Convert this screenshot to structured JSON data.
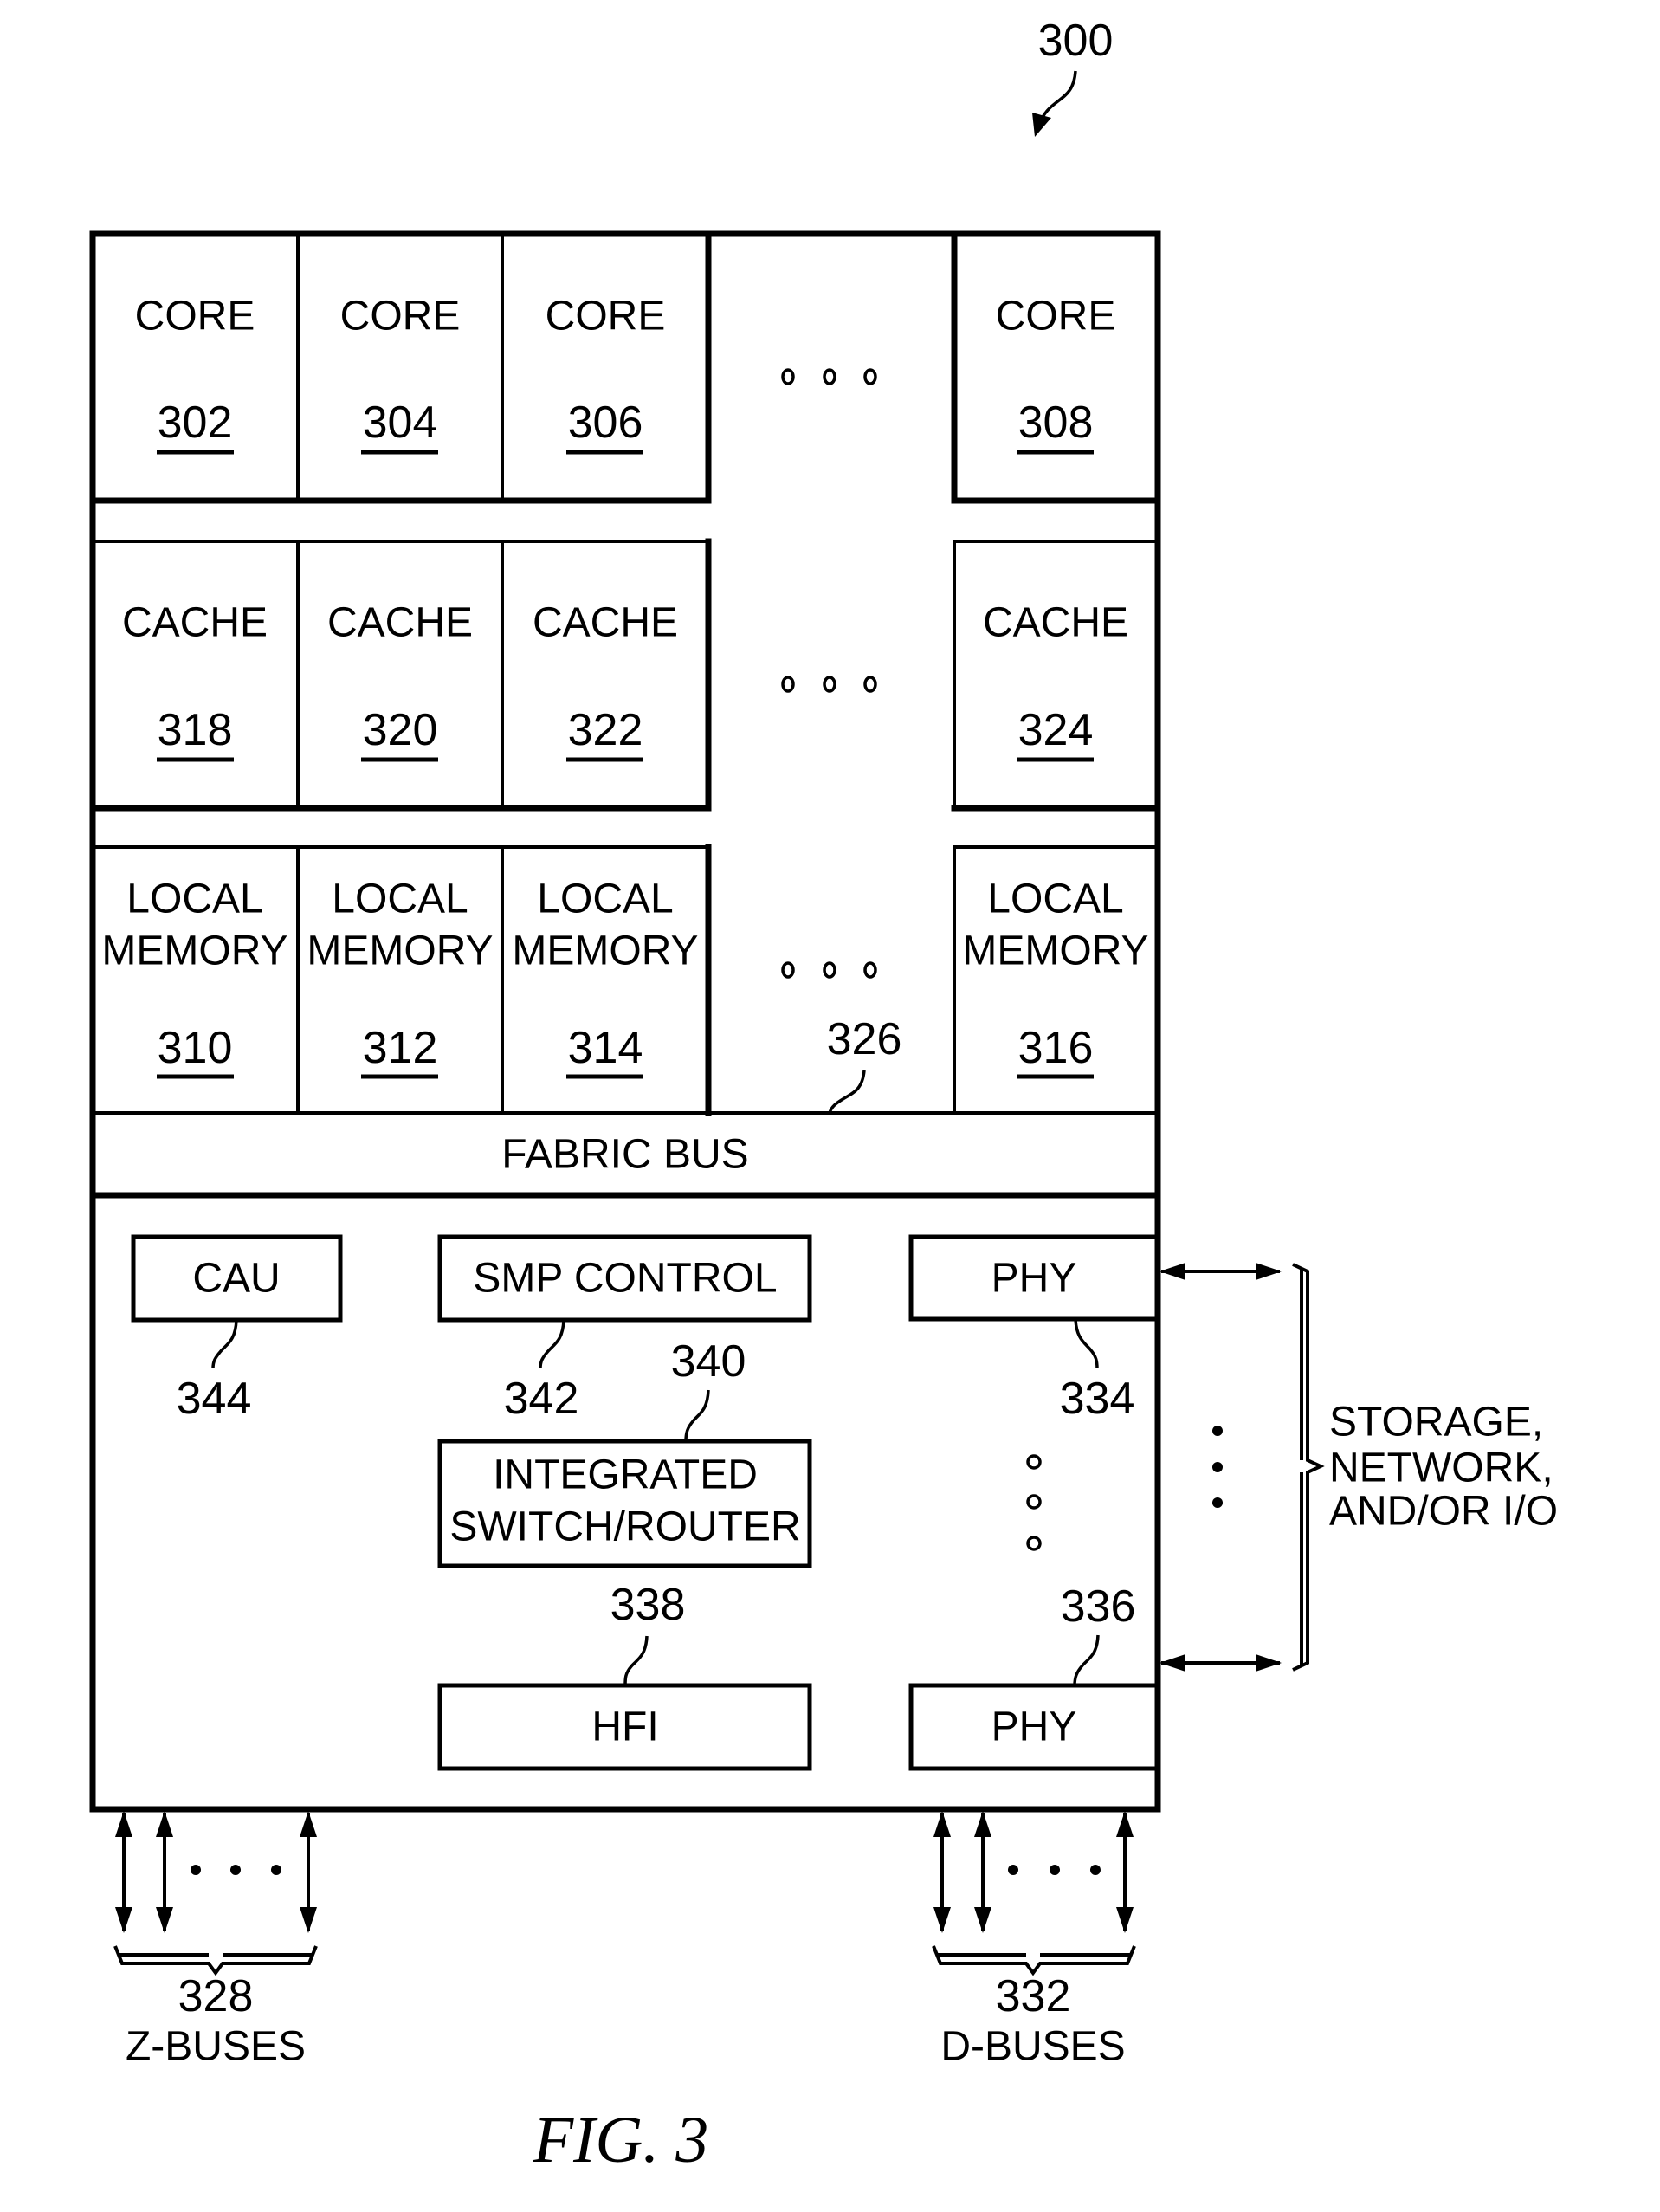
{
  "figure": {
    "ref": "300",
    "caption": "FIG. 3"
  },
  "cores": [
    {
      "label": "CORE",
      "ref": "302"
    },
    {
      "label": "CORE",
      "ref": "304"
    },
    {
      "label": "CORE",
      "ref": "306"
    },
    {
      "label": "CORE",
      "ref": "308"
    }
  ],
  "caches": [
    {
      "label": "CACHE",
      "ref": "318"
    },
    {
      "label": "CACHE",
      "ref": "320"
    },
    {
      "label": "CACHE",
      "ref": "322"
    },
    {
      "label": "CACHE",
      "ref": "324"
    }
  ],
  "memories": [
    {
      "line1": "LOCAL",
      "line2": "MEMORY",
      "ref": "310"
    },
    {
      "line1": "LOCAL",
      "line2": "MEMORY",
      "ref": "312"
    },
    {
      "line1": "LOCAL",
      "line2": "MEMORY",
      "ref": "314"
    },
    {
      "line1": "LOCAL",
      "line2": "MEMORY",
      "ref": "316"
    }
  ],
  "fabric_bus": {
    "label": "FABRIC BUS",
    "ref": "326"
  },
  "cau": {
    "label": "CAU",
    "ref": "344"
  },
  "smp_control": {
    "label": "SMP CONTROL",
    "ref": "342"
  },
  "switch_router": {
    "line1": "INTEGRATED",
    "line2": "SWITCH/ROUTER",
    "ref": "340"
  },
  "hfi": {
    "label": "HFI",
    "ref": "338"
  },
  "phy_top": {
    "label": "PHY",
    "ref": "334"
  },
  "phy_bottom": {
    "label": "PHY",
    "ref": "336"
  },
  "external": {
    "line1": "STORAGE,",
    "line2": "NETWORK,",
    "line3": "AND/OR I/O"
  },
  "z_buses": {
    "ref": "328",
    "label": "Z-BUSES"
  },
  "d_buses": {
    "ref": "332",
    "label": "D-BUSES"
  }
}
